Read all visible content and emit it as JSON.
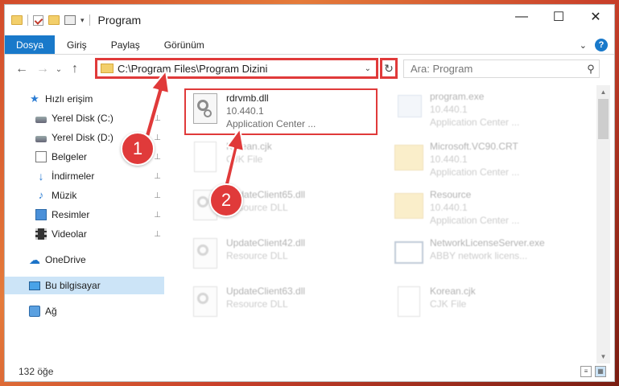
{
  "window": {
    "title": "Program",
    "controls": {
      "minimize": "—",
      "maximize": "☐",
      "close": "✕"
    }
  },
  "ribbon": {
    "tabs": [
      "Dosya",
      "Giriş",
      "Paylaş",
      "Görünüm"
    ],
    "expand_icon": "⌄",
    "help_icon": "?"
  },
  "nav": {
    "back": "←",
    "forward": "→",
    "recent": "⌄",
    "up": "↑",
    "address": "C:\\Program Files\\Program Dizini",
    "address_drop": "⌄",
    "refresh": "↻",
    "search_placeholder": "Ara: Program",
    "search_icon": "⚲"
  },
  "sidebar": {
    "items": [
      {
        "label": "Hızlı erişim",
        "icon": "star-icon",
        "pinned": false
      },
      {
        "label": "Yerel Disk (C:)",
        "icon": "drive-icon",
        "pinned": true
      },
      {
        "label": "Yerel Disk (D:)",
        "icon": "drive-icon",
        "pinned": true
      },
      {
        "label": "Belgeler",
        "icon": "document-icon",
        "pinned": true
      },
      {
        "label": "İndirmeler",
        "icon": "download-icon",
        "pinned": true
      },
      {
        "label": "Müzik",
        "icon": "music-icon",
        "pinned": true
      },
      {
        "label": "Resimler",
        "icon": "pictures-icon",
        "pinned": true
      },
      {
        "label": "Videolar",
        "icon": "videos-icon",
        "pinned": true
      },
      {
        "label": "OneDrive",
        "icon": "cloud-icon",
        "pinned": false
      },
      {
        "label": "Bu bilgisayar",
        "icon": "computer-icon",
        "pinned": false
      },
      {
        "label": "Ağ",
        "icon": "network-icon",
        "pinned": false
      }
    ],
    "pin_glyph": "📌"
  },
  "files": [
    {
      "name": "rdrvmb.dll",
      "line2": "10.440.1",
      "line3": "Application Center ...",
      "type": "dll",
      "highlight": true
    },
    {
      "name": "program.exe",
      "line2": "10.440.1",
      "line3": "Application Center ...",
      "type": "exe"
    },
    {
      "name": "Korean.cjk",
      "line2": "CJK File",
      "line3": "",
      "type": "blank"
    },
    {
      "name": "Microsoft.VC90.CRT",
      "line2": "10.440.1",
      "line3": "Application Center ...",
      "type": "folder"
    },
    {
      "name": "UpdateClient65.dll",
      "line2": "Resource DLL",
      "line3": "",
      "type": "dll"
    },
    {
      "name": "Resource",
      "line2": "10.440.1",
      "line3": "Application Center ...",
      "type": "folder"
    },
    {
      "name": "UpdateClient42.dll",
      "line2": "Resource DLL",
      "line3": "",
      "type": "dll"
    },
    {
      "name": "NetworkLicenseServer.exe",
      "line2": "ABBY network licens...",
      "line3": "",
      "type": "exe2"
    },
    {
      "name": "UpdateClient63.dll",
      "line2": "Resource DLL",
      "line3": "",
      "type": "dll"
    },
    {
      "name": "Korean.cjk",
      "line2": "CJK File",
      "line3": "",
      "type": "blank"
    }
  ],
  "status": {
    "count": "132 öğe"
  },
  "annotations": {
    "callout1": "1",
    "callout2": "2"
  },
  "colors": {
    "accent": "#1979ca",
    "highlight": "#e03a3a"
  }
}
